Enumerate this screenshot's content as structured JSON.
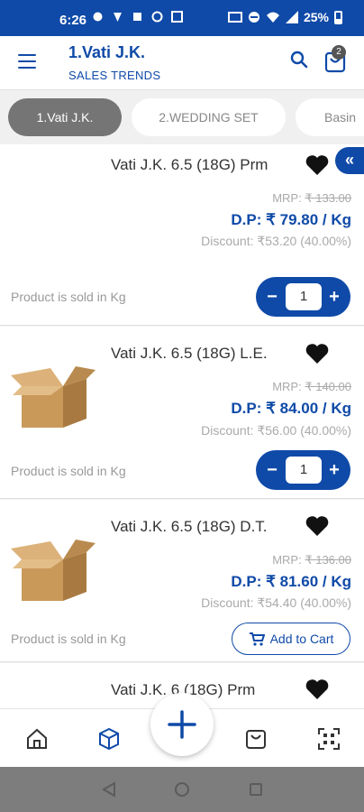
{
  "status_bar": {
    "time": "6:26",
    "battery": "25%"
  },
  "header": {
    "title": "1.Vati J.K.",
    "subtitle": "SALES TRENDS",
    "cart_count": "2"
  },
  "tabs": [
    {
      "label": "1.Vati J.K.",
      "active": true
    },
    {
      "label": "2.WEDDING SET",
      "active": false
    },
    {
      "label": "Basin",
      "active": false
    }
  ],
  "products": [
    {
      "name": "Vati J.K. 6.5 (18G) Prm",
      "mrp_label": "MRP:",
      "mrp": "₹ 133.00",
      "dp": "D.P: ₹ 79.80 / Kg",
      "discount": "Discount: ₹53.20 (40.00%)",
      "sold_text": "Product is sold in Kg",
      "quantity": "1",
      "image": "none"
    },
    {
      "name": "Vati J.K. 6.5 (18G) L.E.",
      "mrp_label": "MRP:",
      "mrp": "₹ 140.00",
      "dp": "D.P: ₹ 84.00 / Kg",
      "discount": "Discount: ₹56.00 (40.00%)",
      "sold_text": "Product is sold in Kg",
      "quantity": "1",
      "image": "box-icon"
    },
    {
      "name": "Vati J.K. 6.5 (18G) D.T.",
      "mrp_label": "MRP:",
      "mrp": "₹ 136.00",
      "dp": "D.P: ₹ 81.60 / Kg",
      "discount": "Discount: ₹54.40 (40.00%)",
      "sold_text": "Product is sold in Kg",
      "add_to_cart": "Add to Cart",
      "image": "box-icon"
    },
    {
      "name": "Vati J.K. 6 (18G) Prm"
    }
  ],
  "stepper": {
    "minus": "−",
    "plus": "+"
  },
  "collapse_tab": "«",
  "colors": {
    "primary": "#0f4aa8",
    "tab_active": "#757575",
    "box": "#c9995a"
  },
  "bottom_nav": [
    "home-icon",
    "cube-icon",
    "plus-icon",
    "bag-icon",
    "qr-scan-icon"
  ]
}
